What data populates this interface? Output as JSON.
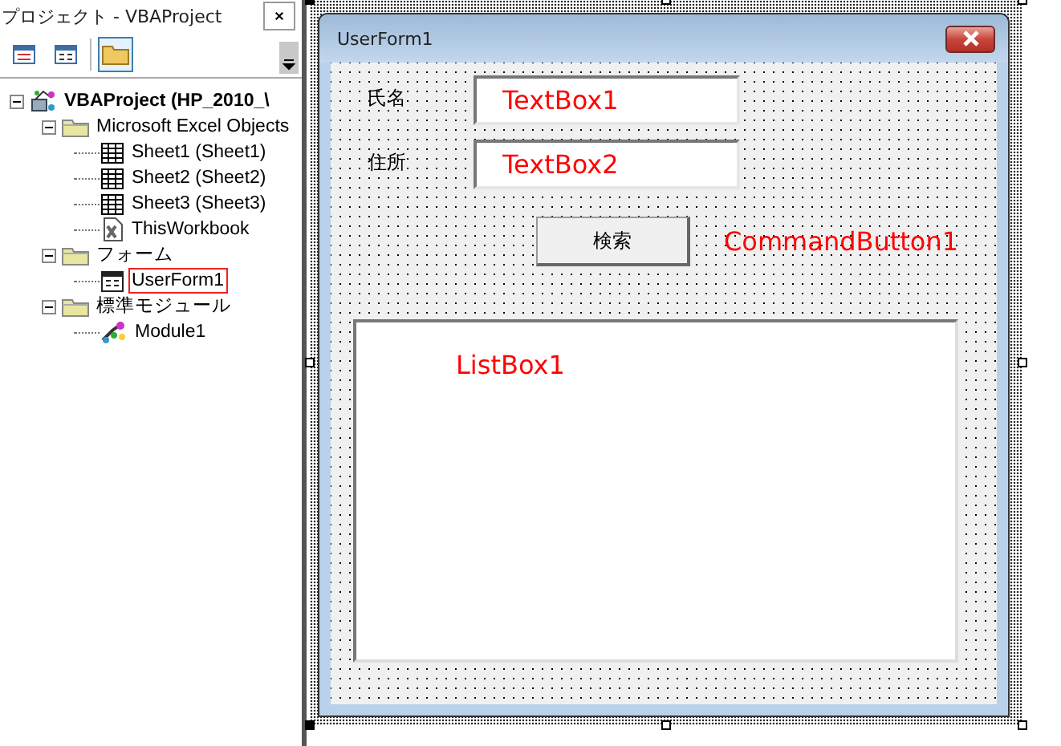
{
  "project_panel": {
    "title": "プロジェクト - VBAProject",
    "toolbar": [
      {
        "kind": "view-code",
        "selected": false
      },
      {
        "kind": "view-object",
        "selected": false
      },
      {
        "kind": "toggle-folders",
        "selected": true
      }
    ],
    "tree": [
      {
        "kind": "project",
        "label": "VBAProject (HP_2010_\\",
        "expanded": true,
        "selected": false,
        "children": [
          {
            "kind": "folder",
            "label": "Microsoft Excel Objects",
            "expanded": true,
            "selected": false,
            "children": [
              {
                "kind": "sheet",
                "label": "Sheet1 (Sheet1)",
                "selected": false
              },
              {
                "kind": "sheet",
                "label": "Sheet2 (Sheet2)",
                "selected": false
              },
              {
                "kind": "sheet",
                "label": "Sheet3 (Sheet3)",
                "selected": false
              },
              {
                "kind": "workbook",
                "label": "ThisWorkbook",
                "selected": false
              }
            ]
          },
          {
            "kind": "folder",
            "label": "フォーム",
            "expanded": true,
            "selected": false,
            "children": [
              {
                "kind": "form",
                "label": "UserForm1",
                "selected": true
              }
            ]
          },
          {
            "kind": "folder",
            "label": "標準モジュール",
            "expanded": true,
            "selected": false,
            "children": [
              {
                "kind": "module",
                "label": "Module1",
                "selected": false
              }
            ]
          }
        ]
      }
    ]
  },
  "user_form": {
    "title": "UserForm1",
    "fields": [
      {
        "label": "氏名",
        "value": "TextBox1"
      },
      {
        "label": "住所",
        "value": "TextBox2"
      }
    ],
    "button": {
      "label": "検索",
      "note": "CommandButton1"
    },
    "listbox": {
      "text": "ListBox1"
    }
  }
}
